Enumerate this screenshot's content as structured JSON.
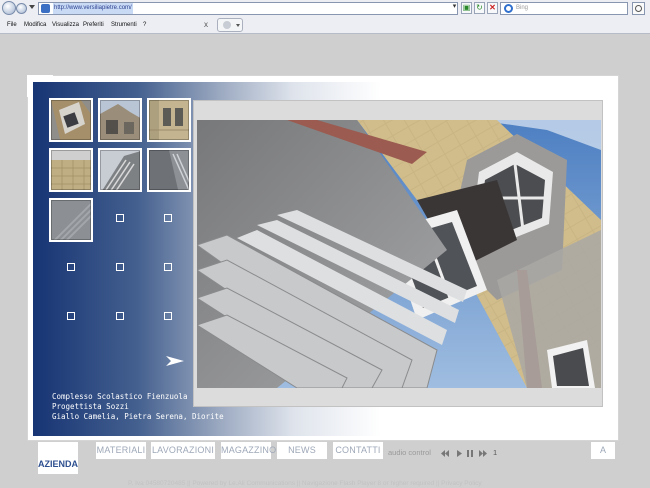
{
  "browser": {
    "url": "http://www.versiliapietre.com/",
    "search_placeholder": "Bing",
    "menu": [
      "File",
      "Modifica",
      "Visualizza",
      "Preferiti",
      "Strumenti",
      "?"
    ],
    "tab_close": "x"
  },
  "gallery": {
    "thumbnails": [
      {
        "name": "thumb-1"
      },
      {
        "name": "thumb-2"
      },
      {
        "name": "thumb-3"
      },
      {
        "name": "thumb-4"
      },
      {
        "name": "thumb-5"
      },
      {
        "name": "thumb-6"
      },
      {
        "name": "thumb-7"
      }
    ],
    "empty_slots": 8
  },
  "caption": {
    "line1": "Complesso Scolastico Fienzuola",
    "line2": "Progettista Sozzi",
    "line3": "Giallo Camelia, Pietra Serena, Diorite"
  },
  "nav": {
    "azienda": "AZIENDA",
    "materiali": "MATERIALI",
    "lavorazioni": "LAVORAZIONI",
    "magazzino": "MAGAZZINO",
    "news": "NEWS",
    "contatti": "CONTATTI",
    "audio_label": "audio control",
    "track": "1",
    "a_button": "A"
  },
  "footer": "P. Iva 04580720485 || Powered by Le.Ali Communications || Navigazione Flash Player 8 or higher required || Privacy Policy",
  "colors": {
    "panel_blue": "#173474",
    "nav_text": "#9ea8b8",
    "active_nav": "#2d4f8f"
  }
}
